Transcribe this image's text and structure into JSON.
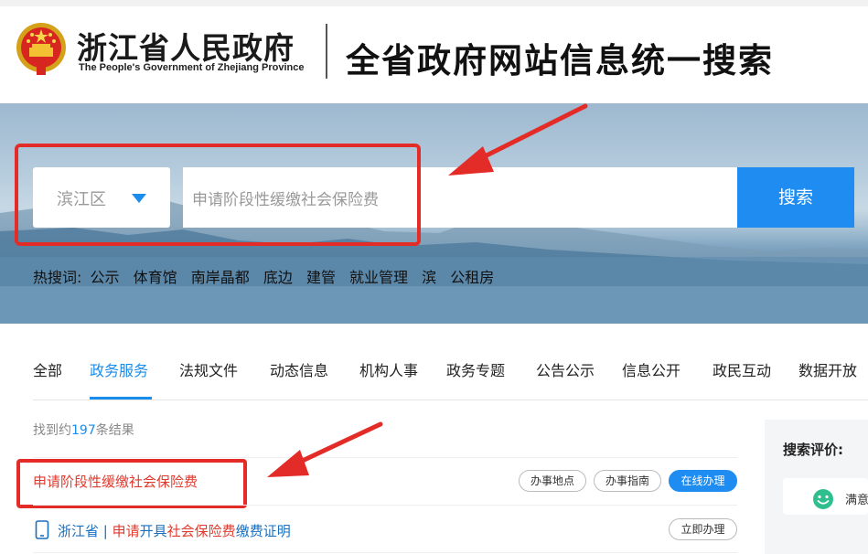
{
  "header": {
    "gov_name_cn": "浙江省人民政府",
    "gov_name_en": "The People's Government of Zhejiang Province",
    "title": "全省政府网站信息统一搜索"
  },
  "search": {
    "region": "滨江区",
    "query_value": "申请阶段性缓缴社会保险费",
    "button_label": "搜索"
  },
  "hot_search": {
    "label": "热搜词:",
    "terms": [
      "公示",
      "体育馆",
      "南岸晶都",
      "底边",
      "建管",
      "就业管理",
      "滨",
      "公租房"
    ]
  },
  "tabs": [
    {
      "label": "全部",
      "active": false
    },
    {
      "label": "政务服务",
      "active": true
    },
    {
      "label": "法规文件",
      "active": false
    },
    {
      "label": "动态信息",
      "active": false
    },
    {
      "label": "机构人事",
      "active": false
    },
    {
      "label": "政务专题",
      "active": false
    },
    {
      "label": "公告公示",
      "active": false
    },
    {
      "label": "信息公开",
      "active": false
    },
    {
      "label": "政民互动",
      "active": false
    },
    {
      "label": "数据开放",
      "active": false
    }
  ],
  "results": {
    "count_prefix": "找到约",
    "count": "197",
    "count_suffix": "条结果",
    "items": [
      {
        "title": "申请阶段性缓缴社会保险费",
        "actions": [
          "办事地点",
          "办事指南",
          "在线办理"
        ]
      },
      {
        "region": "浙江省",
        "separator": "|",
        "parts": [
          "申请",
          "开具",
          "社会保险费",
          "缴费证明"
        ],
        "actions": [
          "立即办理"
        ]
      }
    ]
  },
  "side_panel": {
    "title": "搜索评价:",
    "rating_label": "满意"
  },
  "colors": {
    "accent": "#1e8cf0",
    "highlight": "#e03a2e",
    "annotation": "#e32c28"
  }
}
